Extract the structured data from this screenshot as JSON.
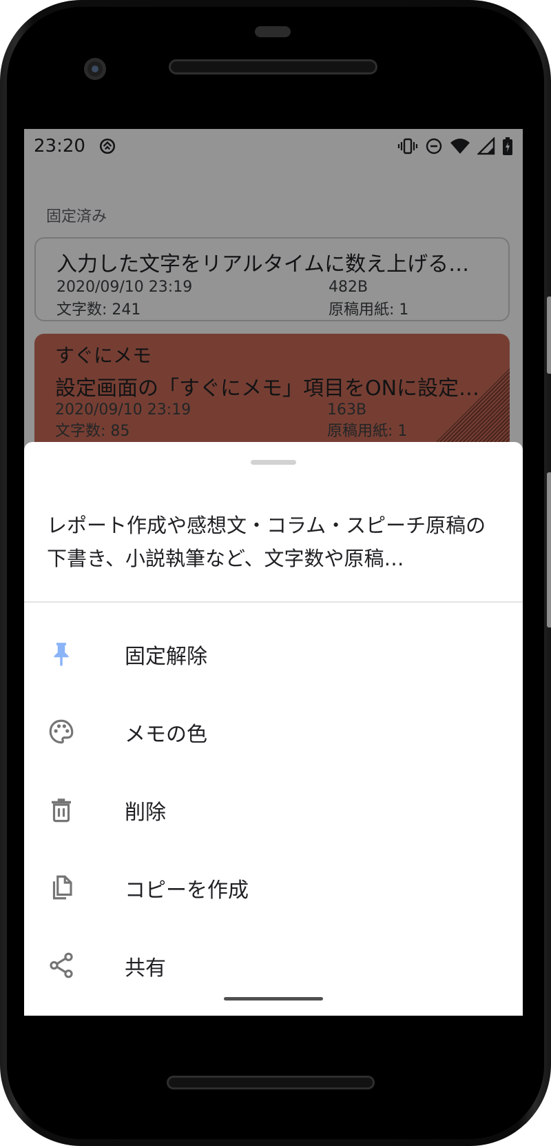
{
  "status_bar": {
    "time": "23:20"
  },
  "list": {
    "section_label": "固定済み",
    "cards": [
      {
        "title": "",
        "body": "入力した文字をリアルタイムに数え上げる…",
        "date": "2020/09/10 23:19",
        "size": "482B",
        "chars": "文字数: 241",
        "sheets": "原稿用紙: 1",
        "color": "#ffffff"
      },
      {
        "title": "すぐにメモ",
        "body": "設定画面の「すぐにメモ」項目をONに設定…",
        "date": "2020/09/10 23:19",
        "size": "163B",
        "chars": "文字数: 85",
        "sheets": "原稿用紙: 1",
        "color": "#cc6b58"
      }
    ]
  },
  "bottom_sheet": {
    "preview": "レポート作成や感想文・コラム・スピーチ原稿の下書き、小説執筆など、文字数や原稿…",
    "menu": [
      {
        "icon": "pin-icon",
        "label": "固定解除",
        "icon_color": "#8ab4f8"
      },
      {
        "icon": "palette-icon",
        "label": "メモの色",
        "icon_color": "#757575"
      },
      {
        "icon": "trash-icon",
        "label": "削除",
        "icon_color": "#757575"
      },
      {
        "icon": "copy-icon",
        "label": "コピーを作成",
        "icon_color": "#757575"
      },
      {
        "icon": "share-icon",
        "label": "共有",
        "icon_color": "#757575"
      }
    ]
  }
}
